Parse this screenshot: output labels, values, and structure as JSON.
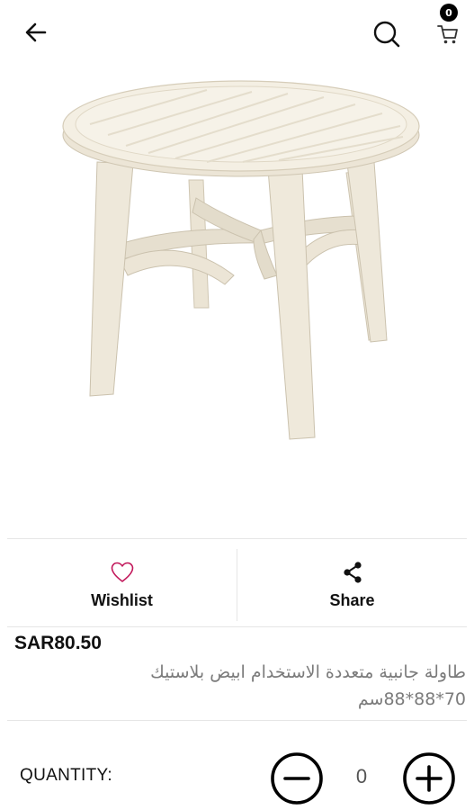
{
  "header": {
    "back_icon": "arrow-left-icon",
    "search_icon": "search-icon",
    "cart_icon": "cart-icon",
    "cart_count": "0"
  },
  "product": {
    "image_alt": "",
    "price": "SAR80.50",
    "title": "طاولة جانبية  متعددة الاستخدام  ابيض بلاستيك 70*88*88سم"
  },
  "actions": {
    "wishlist_label": "Wishlist",
    "wishlist_icon": "heart-icon",
    "wishlist_color": "#c2185b",
    "share_label": "Share",
    "share_icon": "share-icon"
  },
  "quantity": {
    "label": "QUANTITY:",
    "value": "0",
    "minus_icon": "minus-circle-icon",
    "plus_icon": "plus-circle-icon"
  }
}
